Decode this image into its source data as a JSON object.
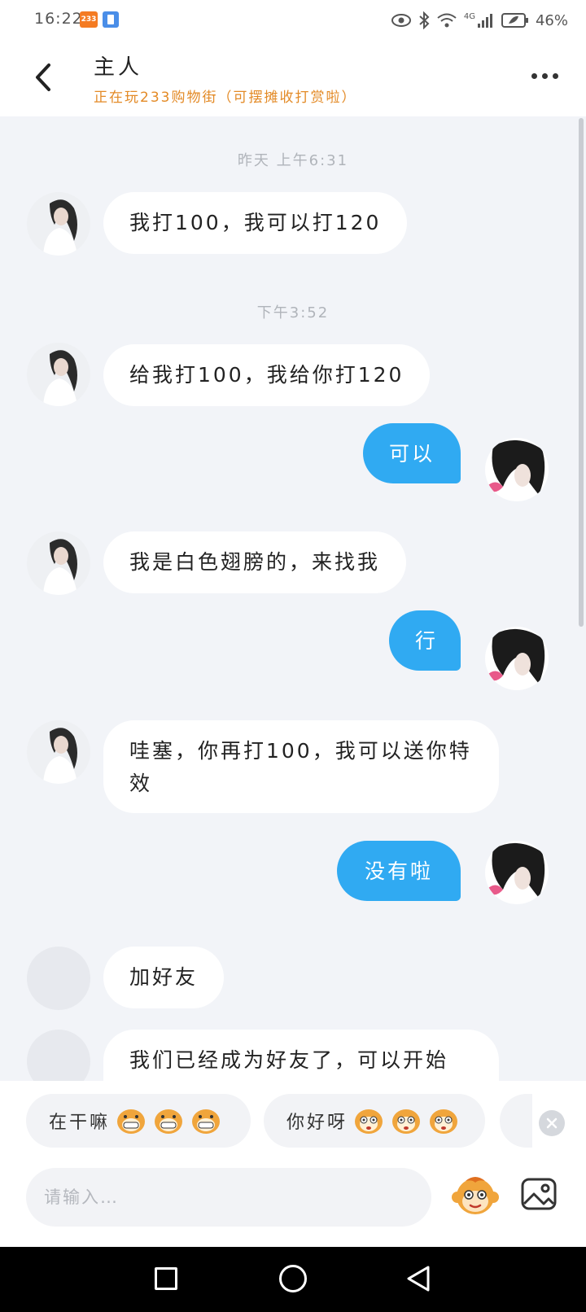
{
  "status_bar": {
    "time": "16:22",
    "badge_label": "233",
    "battery_pct": "46%",
    "network_label": "4G"
  },
  "header": {
    "title": "主人",
    "subtitle": "正在玩233购物街（可摆摊收打赏啦）"
  },
  "messages": [
    {
      "type": "timestamp",
      "text": "昨天 上午6:31"
    },
    {
      "type": "in",
      "text": "我打100，我可以打120"
    },
    {
      "type": "timestamp",
      "text": "下午3:52"
    },
    {
      "type": "in",
      "text": "给我打100，我给你打120"
    },
    {
      "type": "out",
      "text": "可以"
    },
    {
      "type": "in",
      "text": "我是白色翅膀的，来找我"
    },
    {
      "type": "out",
      "text": "行"
    },
    {
      "type": "in",
      "text": "哇塞，你再打100，我可以送你特效"
    },
    {
      "type": "out",
      "text": "没有啦"
    },
    {
      "type": "in",
      "text": "加好友"
    },
    {
      "type": "in",
      "text": "我们已经成为好友了，可以开始"
    }
  ],
  "quick_replies": [
    {
      "label": "在干嘛",
      "face": "grin-face"
    },
    {
      "label": "你好呀",
      "face": "surprised-face"
    }
  ],
  "input": {
    "placeholder": "请输入…"
  },
  "colors": {
    "accent": "#30aaf2",
    "subtitle": "#e38a26",
    "chat_bg": "#f2f4f8"
  },
  "icons": {
    "back": "chevron-left-icon",
    "more": "more-dots-icon",
    "emoji": "emoji-monkey-icon",
    "image": "image-icon",
    "close": "close-icon"
  }
}
